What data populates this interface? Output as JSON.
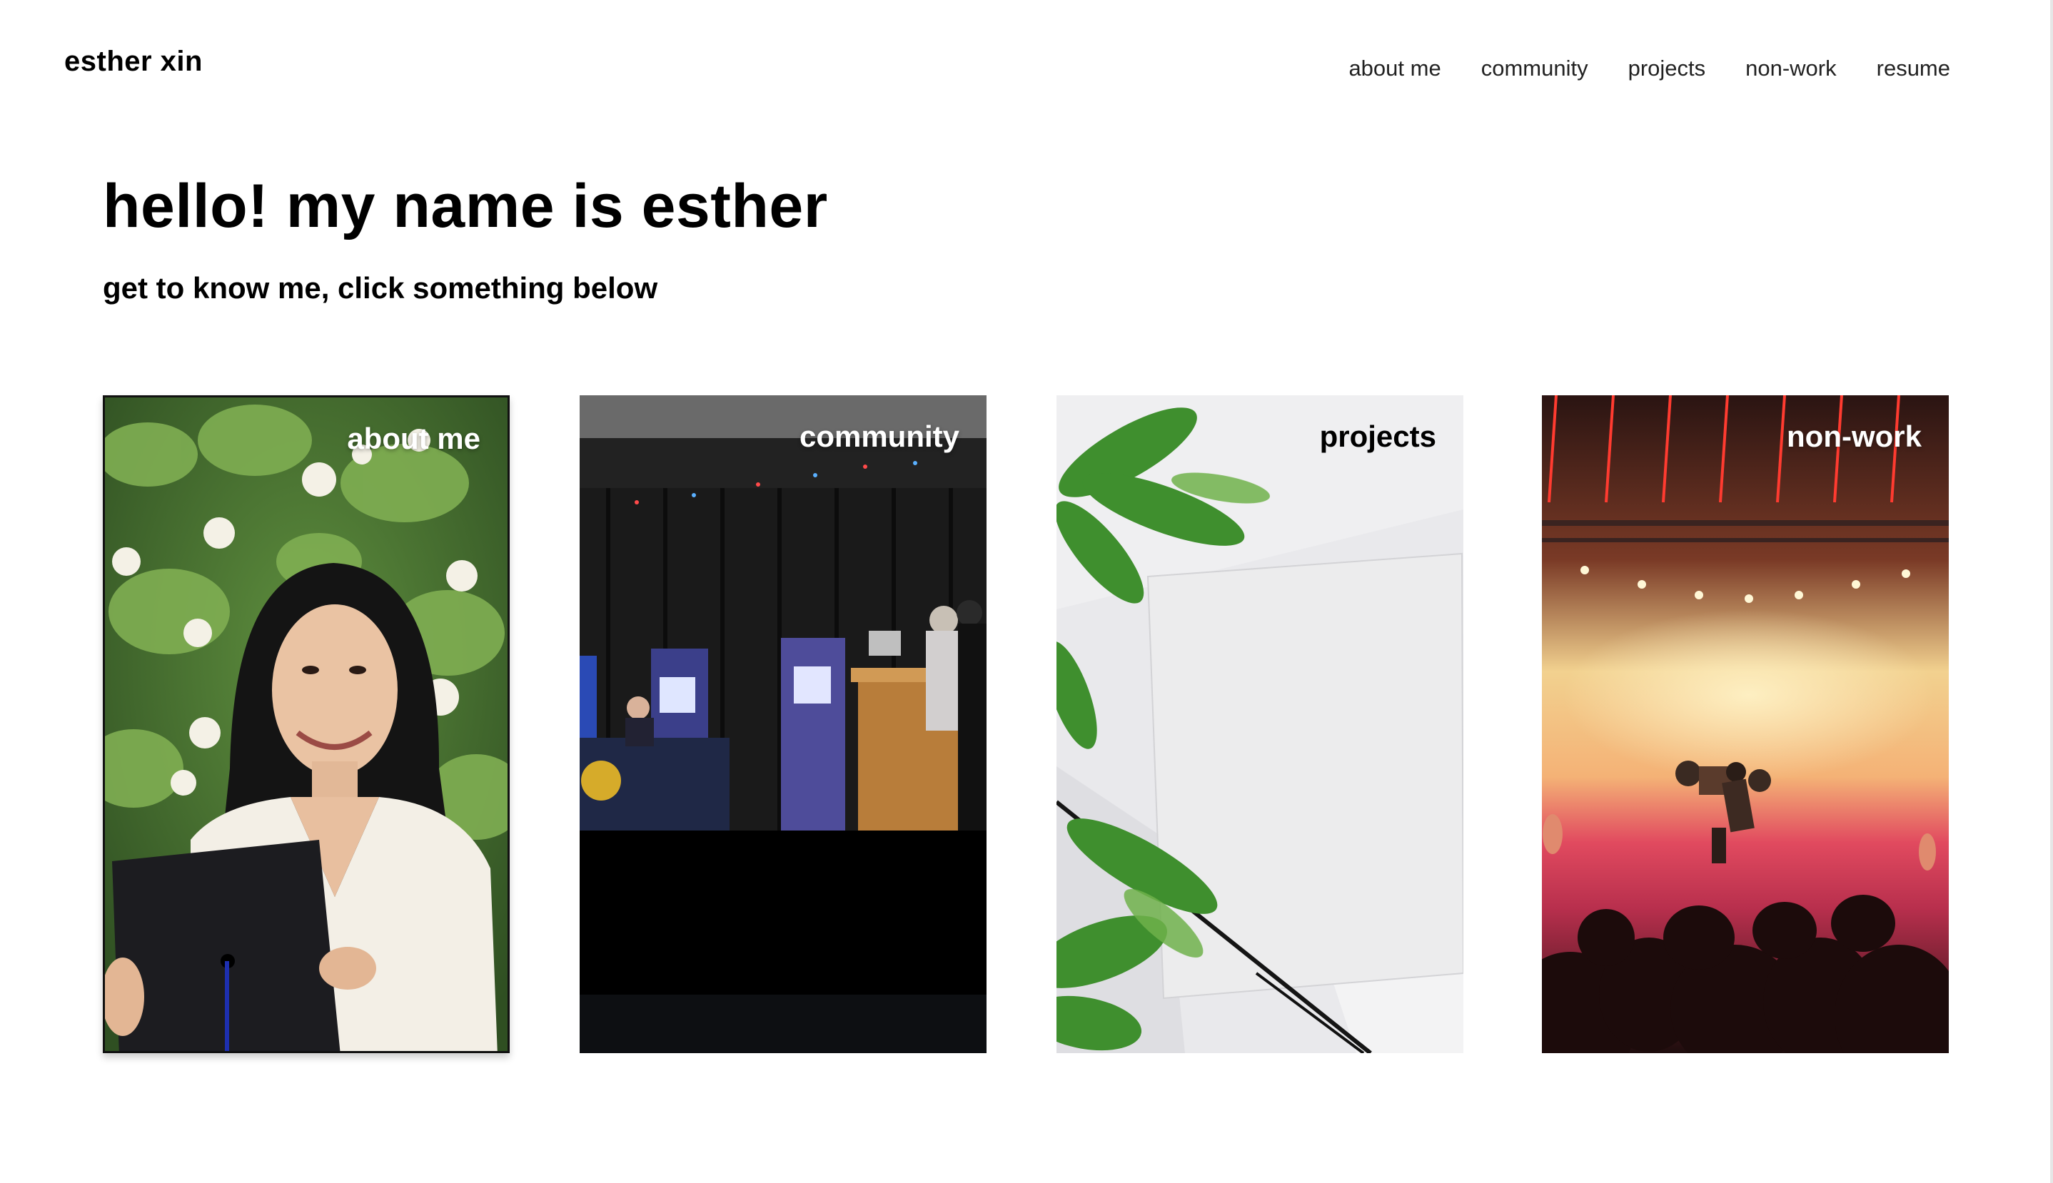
{
  "header": {
    "site_title": "esther xin",
    "nav": [
      {
        "label": "about me"
      },
      {
        "label": "community"
      },
      {
        "label": "projects"
      },
      {
        "label": "non-work"
      },
      {
        "label": "resume"
      }
    ]
  },
  "hero": {
    "title": "hello! my name is esther",
    "subtitle": "get to know me, click something below"
  },
  "cards": [
    {
      "label": "about me",
      "image": "graduation-portrait-photo"
    },
    {
      "label": "community",
      "image": "stage-event-photo"
    },
    {
      "label": "projects",
      "image": "blank-paper-with-leaves-photo"
    },
    {
      "label": "non-work",
      "image": "concert-photo"
    }
  ],
  "colors": {
    "background": "#ffffff",
    "text": "#000000",
    "nav_text": "#222222",
    "card_label_light": "#ffffff",
    "card_label_dark": "#000000"
  }
}
